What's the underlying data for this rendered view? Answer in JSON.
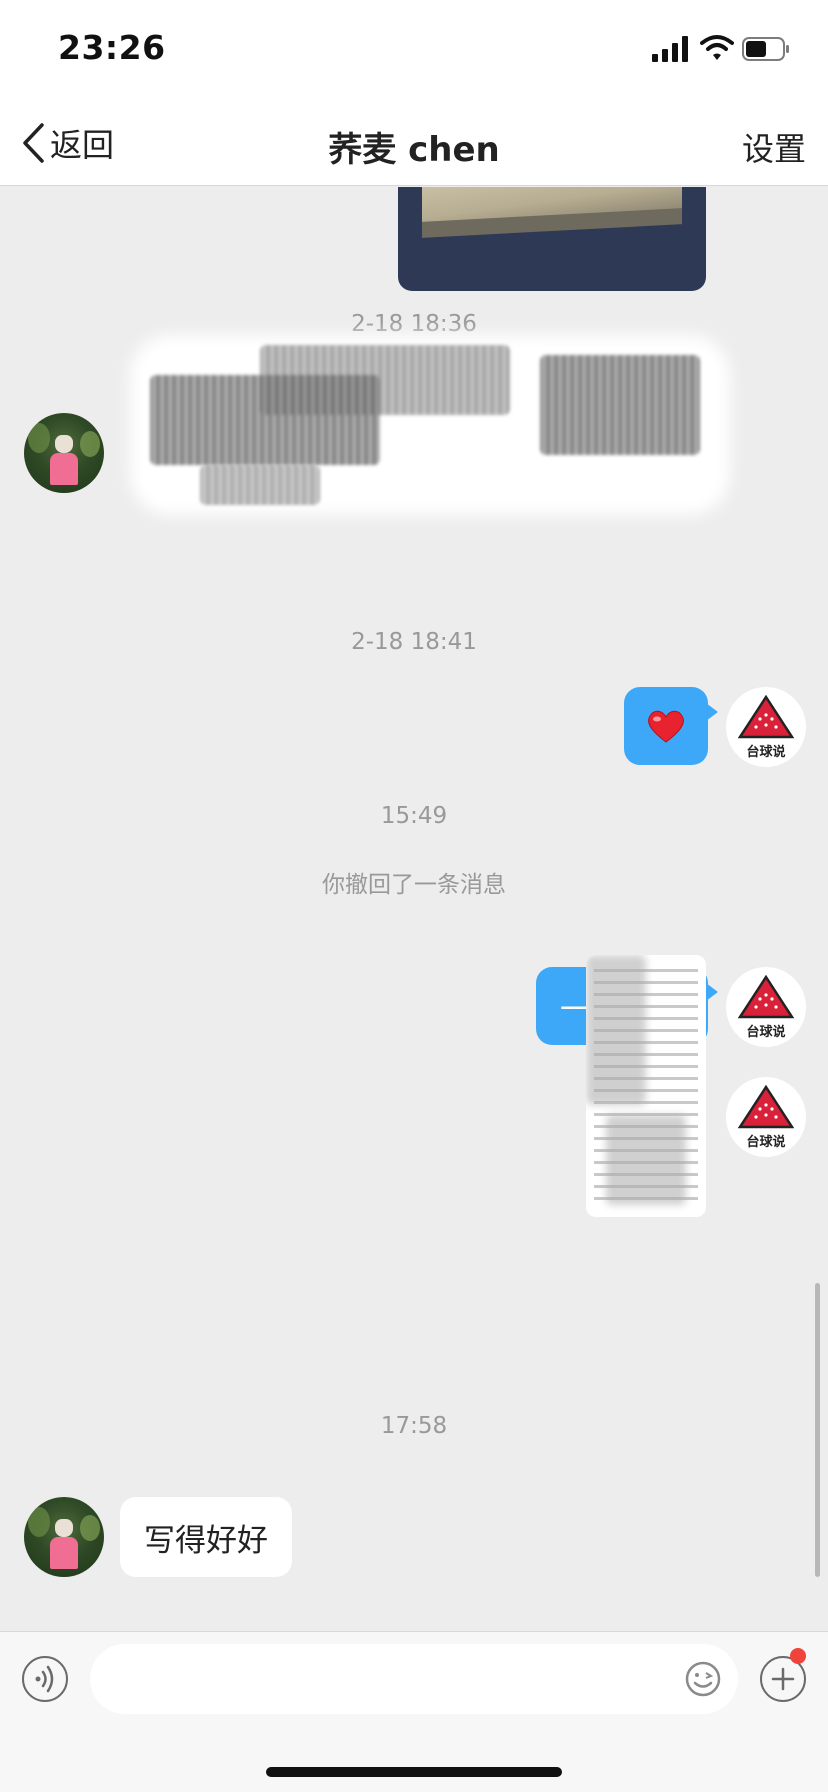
{
  "status_bar": {
    "time": "23:26"
  },
  "nav": {
    "back_label": "返回",
    "title": "荞麦 chen",
    "settings_label": "设置"
  },
  "messages": {
    "ts1": "2-18 18:36",
    "ts2": "2-18 18:41",
    "ts3": "15:49",
    "recalled_notice": "你撤回了一条消息",
    "letter_text": "一封来信",
    "ts4": "17:58",
    "reply_text": "写得好好"
  },
  "self_avatar": {
    "logo_text": "台球说",
    "logo_color": "#d9213a"
  },
  "colors": {
    "accent": "#3ea8f8",
    "badge": "#f0433a",
    "background": "#ededed"
  },
  "input_bar": {
    "placeholder": ""
  }
}
